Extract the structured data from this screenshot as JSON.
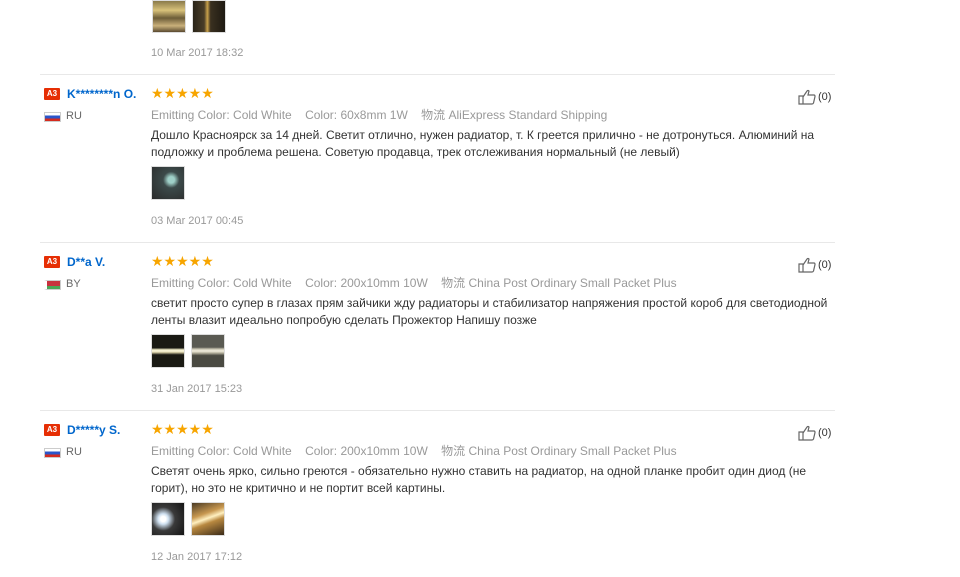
{
  "top_partial": {
    "date": "10 Mar 2017 18:32"
  },
  "labels": {
    "emitting_color": "Emitting Color:",
    "color": "Color:",
    "shipping": "物流"
  },
  "reviews": [
    {
      "badge": "A3",
      "user": "K********n O.",
      "country": "RU",
      "rating": 5,
      "stars": "★★★★★",
      "emitting_color": "Cold White",
      "color": "60x8mm 1W",
      "shipping": "AliExpress Standard Shipping",
      "text": "Дошло Красноярск за 14 дней. Светит отлично, нужен радиатор, т. К греется прилично - не дотронуться. Алюминий на подложку и проблема решена. Советую продавца, трек отслеживания нормальный (не левый)",
      "date": "03 Mar 2017 00:45",
      "likes": "(0)"
    },
    {
      "badge": "A3",
      "user": "D**a V.",
      "country": "BY",
      "rating": 5,
      "stars": "★★★★★",
      "emitting_color": "Cold White",
      "color": "200x10mm 10W",
      "shipping": "China Post Ordinary Small Packet Plus",
      "text": "светит просто супер в глазах прям зайчики жду радиаторы и стабилизатор напряжения простой короб для светодиодной ленты влазит идеально попробую сделать Прожектор Напишу позже",
      "date": "31 Jan 2017 15:23",
      "likes": "(0)"
    },
    {
      "badge": "A3",
      "user": "D*****y S.",
      "country": "RU",
      "rating": 5,
      "stars": "★★★★★",
      "emitting_color": "Cold White",
      "color": "200x10mm 10W",
      "shipping": "China Post Ordinary Small Packet Plus",
      "text": "Светят очень ярко, сильно греются - обязательно нужно ставить на радиатор, на одной планке пробит один диод (не горит), но это не критично и не портит всей картины.",
      "date": "12 Jan 2017 17:12",
      "likes": "(0)"
    }
  ]
}
